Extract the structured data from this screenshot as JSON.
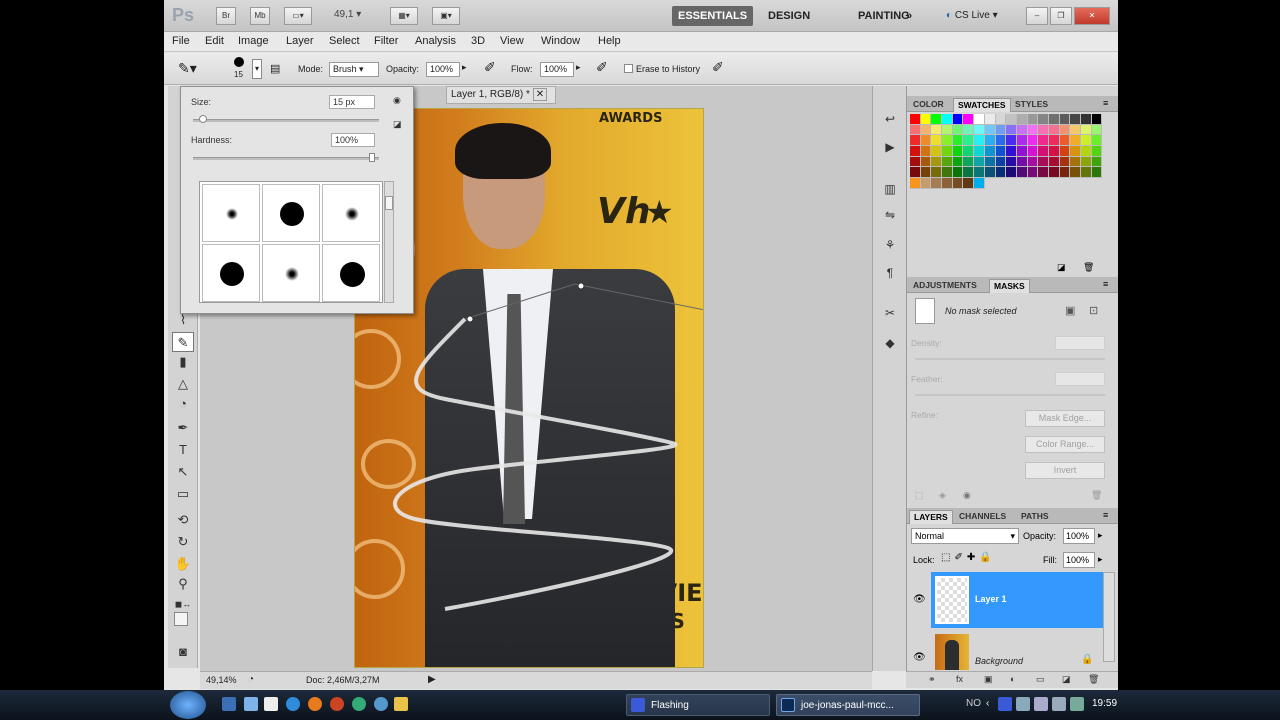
{
  "appbar": {
    "logo": "Ps",
    "zoom": "49,1",
    "workspaces": [
      "ESSENTIALS",
      "DESIGN",
      "PAINTING"
    ],
    "more": "»",
    "cslive": "CS Live"
  },
  "menus": [
    "File",
    "Edit",
    "Image",
    "Layer",
    "Select",
    "Filter",
    "Analysis",
    "3D",
    "View",
    "Window",
    "Help"
  ],
  "options": {
    "brush_size": "15",
    "mode_label": "Mode:",
    "mode_value": "Brush",
    "opacity_label": "Opacity:",
    "opacity_value": "100%",
    "flow_label": "Flow:",
    "flow_value": "100%",
    "erase_history": "Erase to History"
  },
  "brush_picker": {
    "size_label": "Size:",
    "size_value": "15 px",
    "hardness_label": "Hardness:",
    "hardness_value": "100%"
  },
  "document": {
    "tab_title": "Layer 1, RGB/8) *",
    "zoom_status": "49,14%",
    "doc_status": "Doc: 2,46M/3,27M"
  },
  "photo_text": {
    "awards": "AWARDS",
    "vh1": "Vh",
    "star": "★",
    "movie": "MOVIE",
    "ards": "ARDS"
  },
  "color_panel": {
    "tabs": [
      "COLOR",
      "SWATCHES",
      "STYLES"
    ],
    "active": "SWATCHES"
  },
  "adjust_panel": {
    "tabs": [
      "ADJUSTMENTS",
      "MASKS"
    ],
    "active": "MASKS",
    "no_mask": "No mask selected",
    "density": "Density:",
    "feather": "Feather:",
    "refine": "Refine:",
    "buttons": [
      "Mask Edge...",
      "Color Range...",
      "Invert"
    ]
  },
  "layers_panel": {
    "tabs": [
      "LAYERS",
      "CHANNELS",
      "PATHS"
    ],
    "blend_mode": "Normal",
    "opacity_label": "Opacity:",
    "opacity_value": "100%",
    "lock_label": "Lock:",
    "fill_label": "Fill:",
    "fill_value": "100%",
    "layers": [
      {
        "name": "Layer 1",
        "selected": true
      },
      {
        "name": "Background",
        "selected": false
      }
    ]
  },
  "taskbar": {
    "items": [
      "Flashing",
      "joe-jonas-paul-mcc..."
    ],
    "lang": "NO",
    "time": "19:59"
  },
  "colors": {
    "selection_blue": "#3399ff",
    "essentials_bg": "#666666",
    "photo_yellow": "#edc33a"
  }
}
